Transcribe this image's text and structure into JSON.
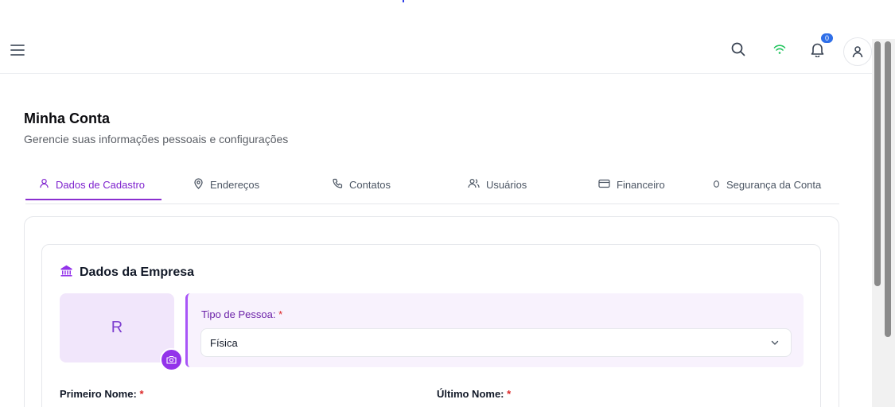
{
  "topbar": {
    "notification_count": "0"
  },
  "page": {
    "title": "Minha Conta",
    "subtitle": "Gerencie suas informações pessoais e configurações"
  },
  "tabs": [
    {
      "label": "Dados de Cadastro",
      "icon": "user-icon"
    },
    {
      "label": "Endereços",
      "icon": "map-pin-icon"
    },
    {
      "label": "Contatos",
      "icon": "phone-icon"
    },
    {
      "label": "Usuários",
      "icon": "users-icon"
    },
    {
      "label": "Financeiro",
      "icon": "credit-card-icon"
    },
    {
      "label": "Segurança da Conta",
      "icon": "shield-icon"
    }
  ],
  "company": {
    "section_title": "Dados da Empresa",
    "avatar_initial": "R",
    "person_type_label": "Tipo de Pessoa:",
    "required_mark": "*",
    "person_type_value": "Física",
    "first_name_label": "Primeiro Nome:",
    "last_name_label": "Último Nome:"
  },
  "colors": {
    "accent": "#8b2fd0",
    "wifi": "#22c55e",
    "badge": "#2f6fe8"
  }
}
